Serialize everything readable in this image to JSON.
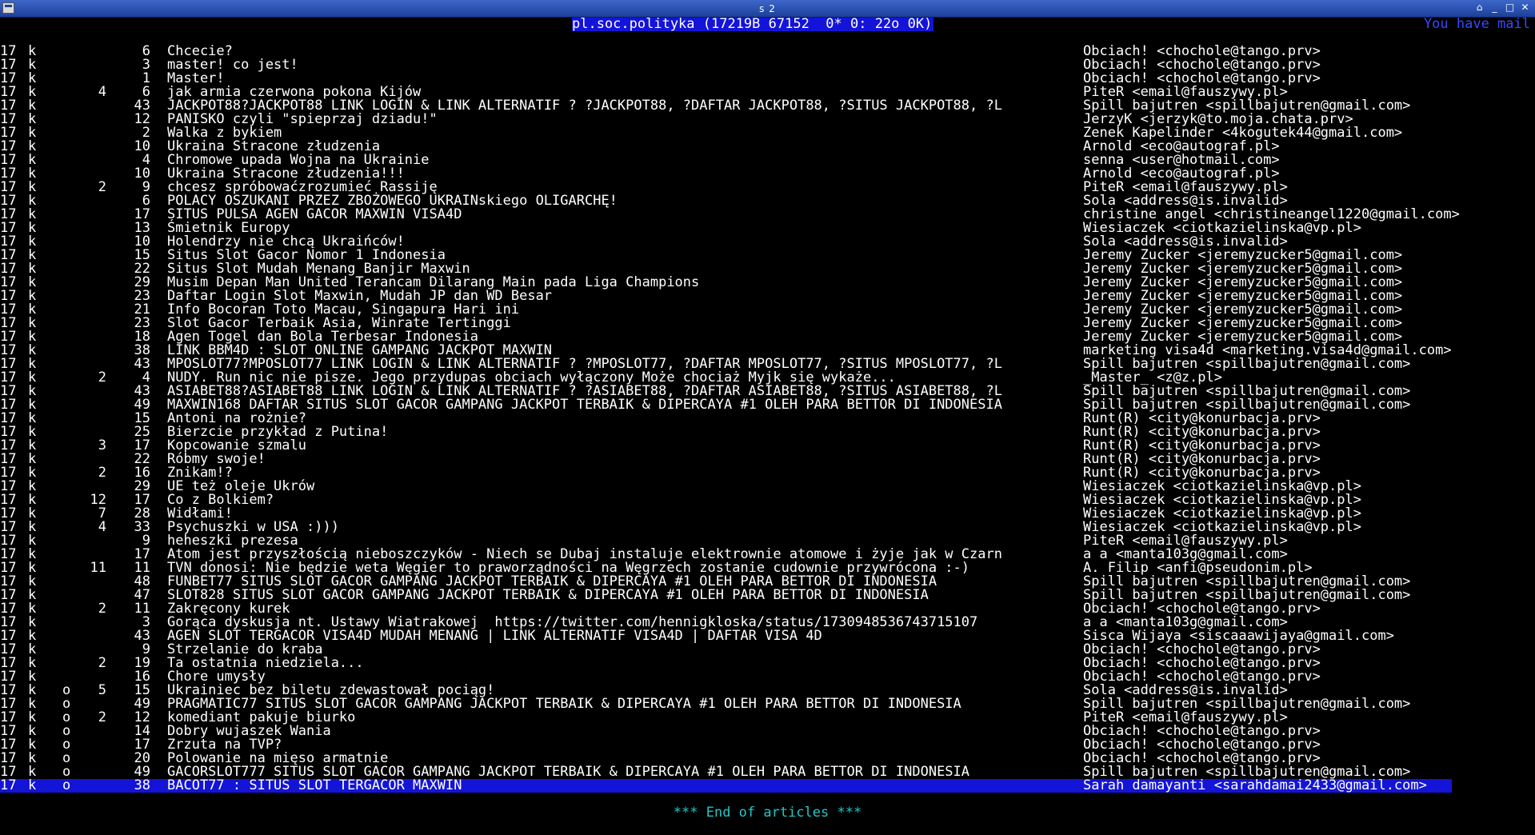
{
  "window": {
    "title": "s 2",
    "buttons": [
      {
        "name": "shade-icon",
        "glyph": "⌂"
      },
      {
        "name": "minimize-icon",
        "glyph": "_"
      },
      {
        "name": "maximize-icon",
        "glyph": "□"
      },
      {
        "name": "close-icon",
        "glyph": "✕"
      }
    ]
  },
  "header": {
    "group_info": "pl.soc.polityka (17219B 67152  0* 0: 22o 0K)",
    "mail_notice": "You have mail"
  },
  "articles": [
    {
      "lines": "17",
      "k": "k",
      "mark": "",
      "thread": "",
      "num": "6",
      "subject": "Chcecie?",
      "author": "Obciach! <chochole@tango.prv>"
    },
    {
      "lines": "17",
      "k": "k",
      "mark": "",
      "thread": "",
      "num": "3",
      "subject": "master! co jest!",
      "author": "Obciach! <chochole@tango.prv>"
    },
    {
      "lines": "17",
      "k": "k",
      "mark": "",
      "thread": "",
      "num": "1",
      "subject": "Master!",
      "author": "Obciach! <chochole@tango.prv>"
    },
    {
      "lines": "17",
      "k": "k",
      "mark": "",
      "thread": "4",
      "num": "6",
      "subject": "jak armia czerwona pokona Kijów",
      "author": "PiteR <email@fauszywy.pl>"
    },
    {
      "lines": "17",
      "k": "k",
      "mark": "",
      "thread": "",
      "num": "43",
      "subject": "JACKPOT88?JACKPOT88 LINK LOGIN & LINK ALTERNATIF ? ?JACKPOT88, ?DAFTAR JACKPOT88, ?SITUS JACKPOT88, ?L",
      "author": "Spill bajutren <spillbajutren@gmail.com>"
    },
    {
      "lines": "17",
      "k": "k",
      "mark": "",
      "thread": "",
      "num": "12",
      "subject": "PANISKO czyli \"spieprzaj dziadu!\"",
      "author": "JerzyK <jerzyk@to.moja.chata.prv>"
    },
    {
      "lines": "17",
      "k": "k",
      "mark": "",
      "thread": "",
      "num": "2",
      "subject": "Walka z bykiem",
      "author": "Zenek Kapelinder <4kogutek44@gmail.com>"
    },
    {
      "lines": "17",
      "k": "k",
      "mark": "",
      "thread": "",
      "num": "10",
      "subject": "Ukraina Stracone złudzenia",
      "author": "Arnold <eco@autograf.pl>"
    },
    {
      "lines": "17",
      "k": "k",
      "mark": "",
      "thread": "",
      "num": "4",
      "subject": "Chromowe upada Wojna na Ukrainie",
      "author": "senna <user@hotmail.com>"
    },
    {
      "lines": "17",
      "k": "k",
      "mark": "",
      "thread": "",
      "num": "10",
      "subject": "Ukraina Stracone złudzenia!!!",
      "author": "Arnold <eco@autograf.pl>"
    },
    {
      "lines": "17",
      "k": "k",
      "mark": "",
      "thread": "2",
      "num": "9",
      "subject": "chcesz spróbowaćzrozumieć Rassiję",
      "author": "PiteR <email@fauszywy.pl>"
    },
    {
      "lines": "17",
      "k": "k",
      "mark": "",
      "thread": "",
      "num": "6",
      "subject": "POLACY OSZUKANI PRZEZ ZBOŻOWEGO UKRAINskiego OLIGARCHĘ!",
      "author": "Sola <address@is.invalid>"
    },
    {
      "lines": "17",
      "k": "k",
      "mark": "",
      "thread": "",
      "num": "17",
      "subject": "SITUS PULSA AGEN GACOR MAXWIN VISA4D",
      "author": "christine angel <christineangel1220@gmail.com>"
    },
    {
      "lines": "17",
      "k": "k",
      "mark": "",
      "thread": "",
      "num": "13",
      "subject": "Śmietnik Europy",
      "author": "Wiesiaczek <ciotkazielinska@vp.pl>"
    },
    {
      "lines": "17",
      "k": "k",
      "mark": "",
      "thread": "",
      "num": "10",
      "subject": "Holendrzy nie chcą Ukraińców!",
      "author": "Sola <address@is.invalid>"
    },
    {
      "lines": "17",
      "k": "k",
      "mark": "",
      "thread": "",
      "num": "15",
      "subject": "Situs Slot Gacor Nomor 1 Indonesia",
      "author": "Jeremy Zucker <jeremyzucker5@gmail.com>"
    },
    {
      "lines": "17",
      "k": "k",
      "mark": "",
      "thread": "",
      "num": "22",
      "subject": "Situs Slot Mudah Menang Banjir Maxwin",
      "author": "Jeremy Zucker <jeremyzucker5@gmail.com>"
    },
    {
      "lines": "17",
      "k": "k",
      "mark": "",
      "thread": "",
      "num": "29",
      "subject": "Musim Depan Man United Terancam Dilarang Main pada Liga Champions",
      "author": "Jeremy Zucker <jeremyzucker5@gmail.com>"
    },
    {
      "lines": "17",
      "k": "k",
      "mark": "",
      "thread": "",
      "num": "23",
      "subject": "Daftar Login Slot Maxwin, Mudah JP dan WD Besar",
      "author": "Jeremy Zucker <jeremyzucker5@gmail.com>"
    },
    {
      "lines": "17",
      "k": "k",
      "mark": "",
      "thread": "",
      "num": "21",
      "subject": "Info Bocoran Toto Macau, Singapura Hari ini",
      "author": "Jeremy Zucker <jeremyzucker5@gmail.com>"
    },
    {
      "lines": "17",
      "k": "k",
      "mark": "",
      "thread": "",
      "num": "23",
      "subject": "Slot Gacor Terbaik Asia, Winrate Tertinggi",
      "author": "Jeremy Zucker <jeremyzucker5@gmail.com>"
    },
    {
      "lines": "17",
      "k": "k",
      "mark": "",
      "thread": "",
      "num": "18",
      "subject": "Agen Togel dan Bola Terbesar Indonesia",
      "author": "Jeremy Zucker <jeremyzucker5@gmail.com>"
    },
    {
      "lines": "17",
      "k": "k",
      "mark": "",
      "thread": "",
      "num": "38",
      "subject": "LINK BBM4D : SLOT ONLINE GAMPANG JACKPOT MAXWIN",
      "author": "marketing visa4d <marketing.visa4d@gmail.com>"
    },
    {
      "lines": "17",
      "k": "k",
      "mark": "",
      "thread": "",
      "num": "43",
      "subject": "MPOSLOT77?MPOSLOT77 LINK LOGIN & LINK ALTERNATIF ? ?MPOSLOT77, ?DAFTAR MPOSLOT77, ?SITUS MPOSLOT77, ?L",
      "author": "Spill bajutren <spillbajutren@gmail.com>"
    },
    {
      "lines": "17",
      "k": "k",
      "mark": "",
      "thread": "2",
      "num": "4",
      "subject": "NUDY. Run nic nie pisze. Jego przydupas obciach wyłączony Może chociaż Myjk się wykaże...",
      "author": "_Master_ <z@z.pl>"
    },
    {
      "lines": "17",
      "k": "k",
      "mark": "",
      "thread": "",
      "num": "43",
      "subject": "ASIABET88?ASIABET88 LINK LOGIN & LINK ALTERNATIF ? ?ASIABET88, ?DAFTAR ASIABET88, ?SITUS ASIABET88, ?L",
      "author": "Spill bajutren <spillbajutren@gmail.com>"
    },
    {
      "lines": "17",
      "k": "k",
      "mark": "",
      "thread": "",
      "num": "49",
      "subject": "MAXWIN168 DAFTAR SITUS SLOT GACOR GAMPANG JACKPOT TERBAIK & DIPERCAYA #1 OLEH PARA BETTOR DI INDONESIA",
      "author": "Spill bajutren <spillbajutren@gmail.com>"
    },
    {
      "lines": "17",
      "k": "k",
      "mark": "",
      "thread": "",
      "num": "15",
      "subject": "Antoni na rożnie?",
      "author": "Runt(R) <city@konurbacja.prv>"
    },
    {
      "lines": "17",
      "k": "k",
      "mark": "",
      "thread": "",
      "num": "25",
      "subject": "Bierzcie przykład z Putina!",
      "author": "Runt(R) <city@konurbacja.prv>"
    },
    {
      "lines": "17",
      "k": "k",
      "mark": "",
      "thread": "3",
      "num": "17",
      "subject": "Kopcowanie szmalu",
      "author": "Runt(R) <city@konurbacja.prv>"
    },
    {
      "lines": "17",
      "k": "k",
      "mark": "",
      "thread": "",
      "num": "22",
      "subject": "Róbmy swoje!",
      "author": "Runt(R) <city@konurbacja.prv>"
    },
    {
      "lines": "17",
      "k": "k",
      "mark": "",
      "thread": "2",
      "num": "16",
      "subject": "Znikam!?",
      "author": "Runt(R) <city@konurbacja.prv>"
    },
    {
      "lines": "17",
      "k": "k",
      "mark": "",
      "thread": "",
      "num": "29",
      "subject": "UE też oleje Ukrów",
      "author": "Wiesiaczek <ciotkazielinska@vp.pl>"
    },
    {
      "lines": "17",
      "k": "k",
      "mark": "",
      "thread": "12",
      "num": "17",
      "subject": "Co z Bolkiem?",
      "author": "Wiesiaczek <ciotkazielinska@vp.pl>"
    },
    {
      "lines": "17",
      "k": "k",
      "mark": "",
      "thread": "7",
      "num": "28",
      "subject": "Widłami!",
      "author": "Wiesiaczek <ciotkazielinska@vp.pl>"
    },
    {
      "lines": "17",
      "k": "k",
      "mark": "",
      "thread": "4",
      "num": "33",
      "subject": "Psychuszki w USA :)))",
      "author": "Wiesiaczek <ciotkazielinska@vp.pl>"
    },
    {
      "lines": "17",
      "k": "k",
      "mark": "",
      "thread": "",
      "num": "9",
      "subject": "heheszki prezesa",
      "author": "PiteR <email@fauszywy.pl>"
    },
    {
      "lines": "17",
      "k": "k",
      "mark": "",
      "thread": "",
      "num": "17",
      "subject": "Atom jest przyszłością nieboszczyków - Niech se Dubaj instaluje elektrownie atomowe i żyje jak w Czarn",
      "author": "a a <manta103g@gmail.com>"
    },
    {
      "lines": "17",
      "k": "k",
      "mark": "",
      "thread": "11",
      "num": "11",
      "subject": "TVN donosi: Nie będzie weta Węgier to praworządności na Węgrzech zostanie cudownie przywrócona :-)",
      "author": "A. Filip <anfi@pseudonim.pl>"
    },
    {
      "lines": "17",
      "k": "k",
      "mark": "",
      "thread": "",
      "num": "48",
      "subject": "FUNBET77 SITUS SLOT GACOR GAMPANG JACKPOT TERBAIK & DIPERCAYA #1 OLEH PARA BETTOR DI INDONESIA",
      "author": "Spill bajutren <spillbajutren@gmail.com>"
    },
    {
      "lines": "17",
      "k": "k",
      "mark": "",
      "thread": "",
      "num": "47",
      "subject": "SLOT828 SITUS SLOT GACOR GAMPANG JACKPOT TERBAIK & DIPERCAYA #1 OLEH PARA BETTOR DI INDONESIA",
      "author": "Spill bajutren <spillbajutren@gmail.com>"
    },
    {
      "lines": "17",
      "k": "k",
      "mark": "",
      "thread": "2",
      "num": "11",
      "subject": "Zakręcony kurek",
      "author": "Obciach! <chochole@tango.prv>"
    },
    {
      "lines": "17",
      "k": "k",
      "mark": "",
      "thread": "",
      "num": "3",
      "subject": "Gorąca dyskusja nt. Ustawy Wiatrakowej  https://twitter.com/hennigkloska/status/1730948536743715107",
      "author": "a a <manta103g@gmail.com>"
    },
    {
      "lines": "17",
      "k": "k",
      "mark": "",
      "thread": "",
      "num": "43",
      "subject": "AGEN SLOT TERGACOR VISA4D MUDAH MENANG | LINK ALTERNATIF VISA4D | DAFTAR VISA 4D",
      "author": "Sisca Wijaya <siscaaawijaya@gmail.com>"
    },
    {
      "lines": "17",
      "k": "k",
      "mark": "",
      "thread": "",
      "num": "9",
      "subject": "Strzelanie do kraba",
      "author": "Obciach! <chochole@tango.prv>"
    },
    {
      "lines": "17",
      "k": "k",
      "mark": "",
      "thread": "2",
      "num": "19",
      "subject": "Ta ostatnia niedziela...",
      "author": "Obciach! <chochole@tango.prv>"
    },
    {
      "lines": "17",
      "k": "k",
      "mark": "",
      "thread": "",
      "num": "16",
      "subject": "Chore umysły",
      "author": "Obciach! <chochole@tango.prv>"
    },
    {
      "lines": "17",
      "k": "k",
      "mark": "o",
      "thread": "5",
      "num": "15",
      "subject": "Ukrainiec bez biletu zdewastował pociąg!",
      "author": "Sola <address@is.invalid>"
    },
    {
      "lines": "17",
      "k": "k",
      "mark": "o",
      "thread": "",
      "num": "49",
      "subject": "PRAGMATIC77 SITUS SLOT GACOR GAMPANG JACKPOT TERBAIK & DIPERCAYA #1 OLEH PARA BETTOR DI INDONESIA",
      "author": "Spill bajutren <spillbajutren@gmail.com>"
    },
    {
      "lines": "17",
      "k": "k",
      "mark": "o",
      "thread": "2",
      "num": "12",
      "subject": "komediant pakuje biurko",
      "author": "PiteR <email@fauszywy.pl>"
    },
    {
      "lines": "17",
      "k": "k",
      "mark": "o",
      "thread": "",
      "num": "14",
      "subject": "Dobry wujaszek Wania",
      "author": "Obciach! <chochole@tango.prv>"
    },
    {
      "lines": "17",
      "k": "k",
      "mark": "o",
      "thread": "",
      "num": "17",
      "subject": "Zrzuta na TVP?",
      "author": "Obciach! <chochole@tango.prv>"
    },
    {
      "lines": "17",
      "k": "k",
      "mark": "o",
      "thread": "",
      "num": "20",
      "subject": "Polowanie na mięso armatnie",
      "author": "Obciach! <chochole@tango.prv>"
    },
    {
      "lines": "17",
      "k": "k",
      "mark": "o",
      "thread": "",
      "num": "49",
      "subject": "GACORSLOT777 SITUS SLOT GACOR GAMPANG JACKPOT TERBAIK & DIPERCAYA #1 OLEH PARA BETTOR DI INDONESIA",
      "author": "Spill bajutren <spillbajutren@gmail.com>"
    },
    {
      "lines": "17",
      "k": "k",
      "mark": "o",
      "thread": "",
      "num": "38",
      "subject": "BACOT77 : SITUS SLOT TERGACOR MAXWIN",
      "author": "Sarah damayanti <sarahdamai2433@gmail.com>",
      "selected": true
    }
  ],
  "footer": "*** End of articles ***",
  "colors": {
    "background": "#000000",
    "text": "#ffffff",
    "highlight": "#1414d8",
    "mail_notice": "#3a48ff",
    "footer": "#22c8c8",
    "titlebar": "#1c3f9a"
  }
}
